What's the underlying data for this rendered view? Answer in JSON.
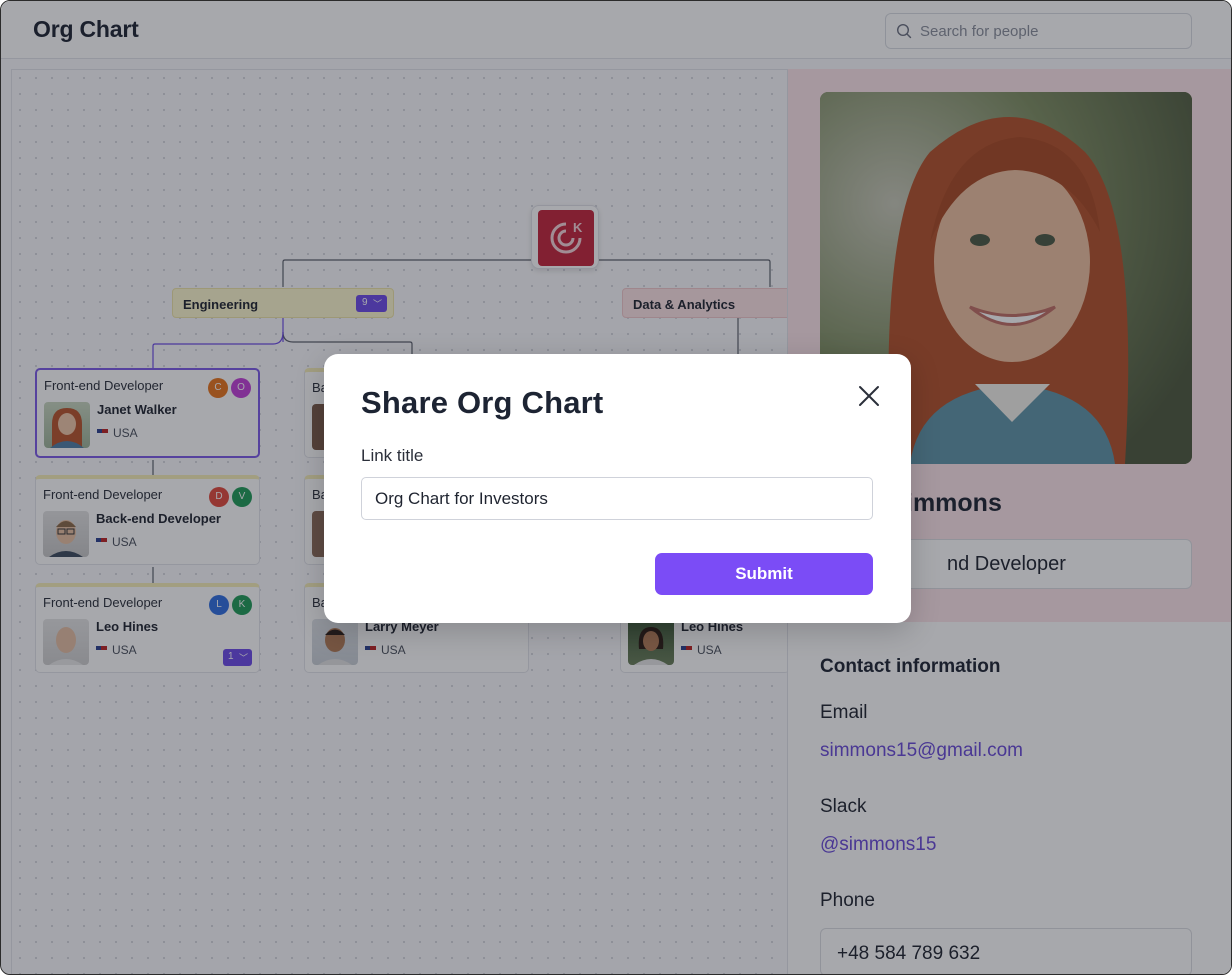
{
  "header": {
    "title": "Org Chart",
    "search_placeholder": "Search for people"
  },
  "chart": {
    "departments": [
      {
        "name": "Engineering",
        "count": "9"
      },
      {
        "name": "Data & Analytics"
      }
    ],
    "column1": [
      {
        "role": "Front-end Developer",
        "name": "Janet Walker",
        "country": "USA",
        "avatars": [
          "C",
          "O"
        ]
      },
      {
        "role": "Front-end Developer",
        "name": "Back-end Developer",
        "country": "USA",
        "avatars": [
          "D",
          "V"
        ]
      },
      {
        "role": "Front-end Developer",
        "name": "Leo Hines",
        "country": "USA",
        "avatars": [
          "L",
          "K"
        ],
        "sub_count": "1"
      }
    ],
    "column2": [
      {
        "role": "Ba"
      },
      {
        "role": "Ba"
      },
      {
        "role": "Ba",
        "name": "Larry Meyer",
        "country": "USA"
      }
    ],
    "column3": [
      {
        "name": "Leo Hines",
        "country": "USA"
      }
    ],
    "root_logo_letter": "K"
  },
  "profile": {
    "name_partial": "immons",
    "role_partial": "nd Developer",
    "contact_heading": "Contact information",
    "email_label": "Email",
    "email": "simmons15@gmail.com",
    "slack_label": "Slack",
    "slack": "@simmons15",
    "phone_label": "Phone",
    "phone": "+48 584 789 632"
  },
  "modal": {
    "title": "Share Org Chart",
    "field_label": "Link title",
    "field_value": "Org Chart for Investors",
    "submit_label": "Submit"
  },
  "colors": {
    "accent": "#7b4cf6",
    "badge": "#6d4be8",
    "link": "#6a4bd8",
    "brand_logo": "#c4243b"
  }
}
